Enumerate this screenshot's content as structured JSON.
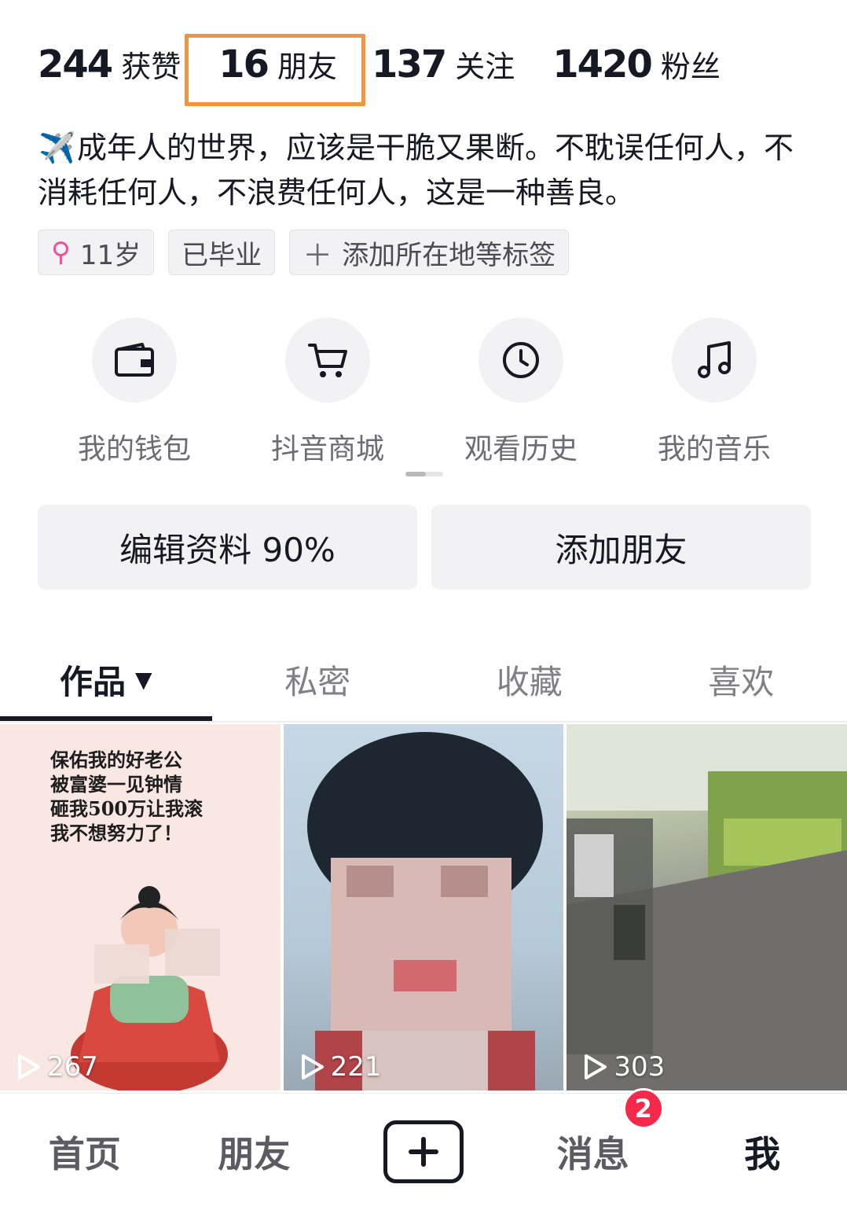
{
  "stats": [
    {
      "num": "244",
      "label": "获赞"
    },
    {
      "num": "16",
      "label": "朋友"
    },
    {
      "num": "137",
      "label": "关注"
    },
    {
      "num": "1420",
      "label": "粉丝"
    }
  ],
  "bio": {
    "icon": "✈️",
    "text": "成年人的世界，应该是干脆又果断。不耽误任何人，不消耗任何人，不浪费任何人，这是一种善良。"
  },
  "tags": {
    "gender_icon": "⚲",
    "age": "11岁",
    "school": "已毕业",
    "add": "添加所在地等标签"
  },
  "shortcuts": [
    {
      "icon": "wallet-icon",
      "label": "我的钱包"
    },
    {
      "icon": "cart-icon",
      "label": "抖音商城"
    },
    {
      "icon": "clock-icon",
      "label": "观看历史"
    },
    {
      "icon": "music-icon",
      "label": "我的音乐"
    }
  ],
  "actions": {
    "edit": "编辑资料 90%",
    "add_friend": "添加朋友"
  },
  "tabs": {
    "works": "作品",
    "caret": "▼",
    "private": "私密",
    "favorites": "收藏",
    "likes": "喜欢"
  },
  "videos": [
    {
      "views": "267",
      "caption_lines": [
        "保佑我的好老公",
        "被富婆一见钟情",
        "砸我500万让我滚",
        "我不想努力了！"
      ]
    },
    {
      "views": "221"
    },
    {
      "views": "303"
    }
  ],
  "nav": {
    "home": "首页",
    "friends": "朋友",
    "messages": "消息",
    "badge": "2",
    "me": "我"
  },
  "colors": {
    "highlight_box": "#f5923e",
    "badge": "#f8284a",
    "gender": "#f0509a"
  }
}
